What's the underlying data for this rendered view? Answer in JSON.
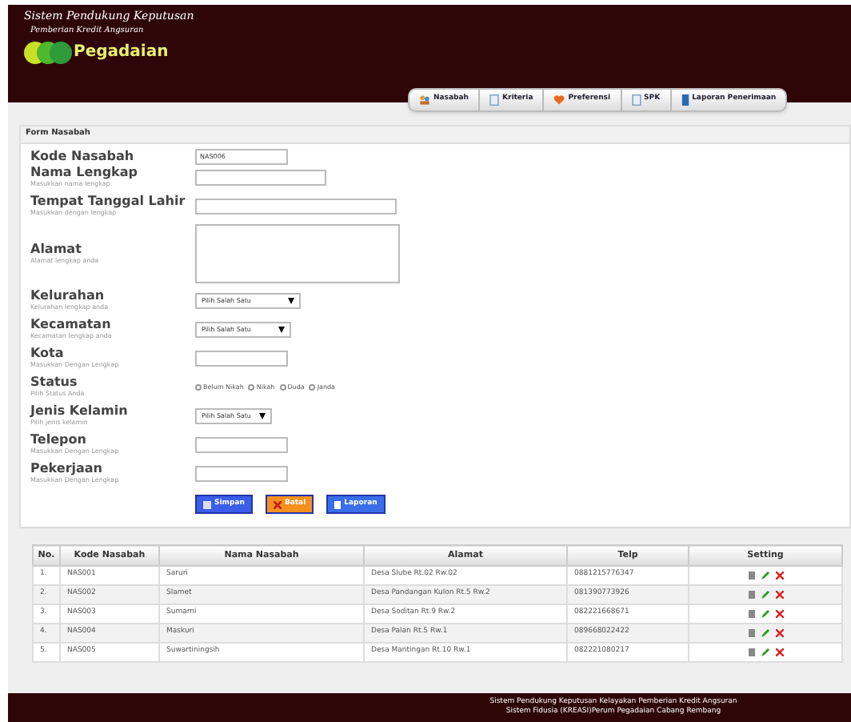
{
  "header": {
    "title_line1": "Sistem Pendukung Keputusan",
    "title_line2": "Pemberian Kredit Angsuran",
    "logo_text": "Pegadaian"
  },
  "nav": [
    {
      "label": "Nasabah"
    },
    {
      "label": "Kriteria"
    },
    {
      "label": "Preferensi"
    },
    {
      "label": "SPK"
    },
    {
      "label": "Laporan Penerimaan"
    }
  ],
  "form": {
    "title": "Form Nasabah",
    "fields": [
      {
        "kind": "text",
        "label": "Kode Nasabah",
        "value": "NAS006"
      },
      {
        "kind": "text",
        "label": "Nama Lengkap",
        "hint": "Masukkan nama lengkap"
      },
      {
        "kind": "text",
        "label": "Tempat Tanggal Lahir",
        "hint": "Masukkan dengan lengkap"
      },
      {
        "kind": "textarea",
        "label": "Alamat",
        "hint": "Alamat lengkap anda"
      },
      {
        "kind": "select",
        "label": "Kelurahan",
        "hint": "Kelurahan lengkap anda",
        "value": "Pilih Salah Satu"
      },
      {
        "kind": "select",
        "label": "Kecamatan",
        "hint": "Kecamatan lengkap anda",
        "value": "Pilih Salah Satu"
      },
      {
        "kind": "text",
        "label": "Kota",
        "hint": "Masukkan Dengan Lengkap"
      },
      {
        "kind": "radio",
        "label": "Status",
        "hint": "Pilih Status Anda",
        "options": [
          {
            "label": "Belum Nikah",
            "selected": false
          },
          {
            "label": "Nikah",
            "selected": false
          },
          {
            "label": "Duda",
            "selected": false
          },
          {
            "label": "Janda",
            "selected": false
          }
        ]
      },
      {
        "kind": "select",
        "label": "Jenis Kelamin",
        "hint": "Pilih jenis kelamin",
        "value": "Pilih Salah Satu"
      },
      {
        "kind": "text",
        "label": "Telepon",
        "hint": "Masukkan Dengan Lengkap"
      },
      {
        "kind": "text",
        "label": "Pekerjaan",
        "hint": "Masukkan Dengan Lengkap"
      }
    ],
    "buttons": [
      {
        "label": "Simpan",
        "kind": "save"
      },
      {
        "label": "Batal",
        "kind": "cancel"
      },
      {
        "label": "Laporan",
        "kind": "report"
      }
    ]
  },
  "table": {
    "columns": [
      "No.",
      "Kode Nasabah",
      "Nama Nasabah",
      "Alamat",
      "Telp",
      "Setting"
    ],
    "rows": [
      [
        "1.",
        "NAS001",
        "Saruri",
        "Desa Slube Rt.02 Rw.02",
        "0881215776347"
      ],
      [
        "2.",
        "NAS002",
        "Slamet",
        "Desa Pandangan Kulon Rt.5 Rw.2",
        "081390773926"
      ],
      [
        "3.",
        "NAS003",
        "Sumarni",
        "Desa Soditan Rt.9 Rw.2",
        "082221668671"
      ],
      [
        "4.",
        "NAS004",
        "Maskuri",
        "Desa Palan Rt.5 Rw.1",
        "089668022422"
      ],
      [
        "5.",
        "NAS005",
        "Suwartiningsih",
        "Desa Mantingan Rt.10 Rw.1",
        "082221080217"
      ]
    ]
  },
  "footer": {
    "line1": "Sistem Pendukung Keputusan Kelayakan Pemberian Kredit Angsuran",
    "line2": "Sistem Fidusia (KREASI)Perum Pegadaian Cabang Rembang"
  }
}
